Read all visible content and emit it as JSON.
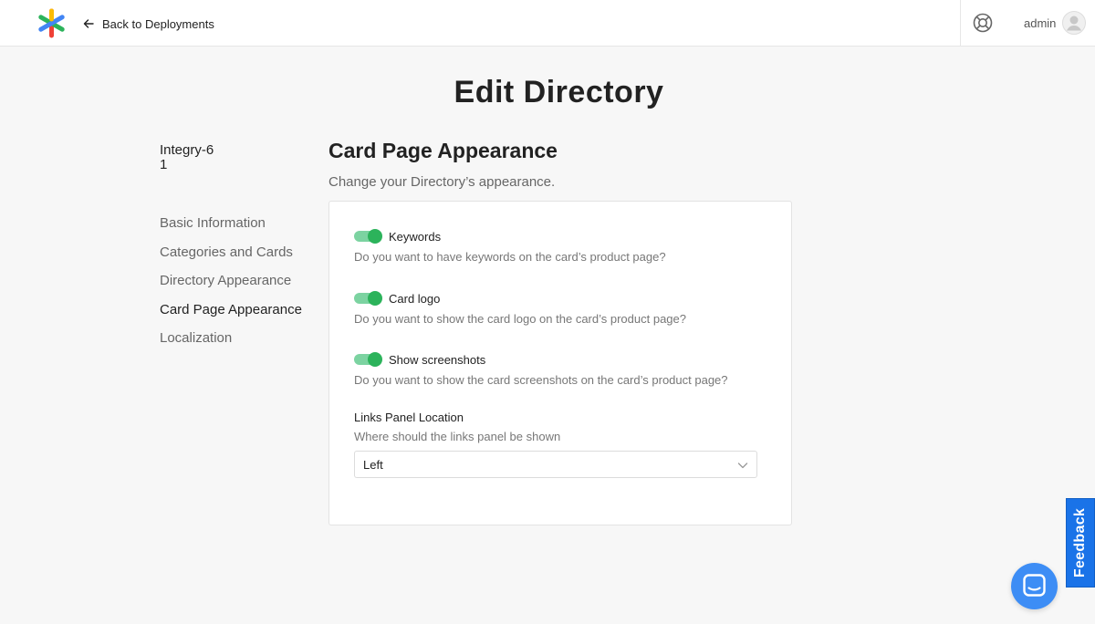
{
  "header": {
    "back_label": "Back to Deployments",
    "user_name": "admin"
  },
  "page": {
    "title": "Edit Directory"
  },
  "sidebar": {
    "directory_name": "Integry-61",
    "items": [
      {
        "label": "Basic Information",
        "active": false
      },
      {
        "label": "Categories and Cards",
        "active": false
      },
      {
        "label": "Directory Appearance",
        "active": false
      },
      {
        "label": "Card Page Appearance",
        "active": true
      },
      {
        "label": "Localization",
        "active": false
      }
    ]
  },
  "section": {
    "title": "Card Page Appearance",
    "subtitle": "Change your Directory’s appearance.",
    "settings": [
      {
        "label": "Keywords",
        "enabled": true,
        "description": "Do you want to have keywords on the card’s product page?"
      },
      {
        "label": "Card logo",
        "enabled": true,
        "description": "Do you want to show the card logo on the card’s product page?"
      },
      {
        "label": "Show screenshots",
        "enabled": true,
        "description": "Do you want to show the card screenshots on the card’s product page?"
      }
    ],
    "links_panel": {
      "title": "Links Panel Location",
      "description": "Where should the links panel be shown",
      "selected": "Left"
    }
  },
  "widgets": {
    "feedback_label": "Feedback"
  },
  "colors": {
    "toggle_on": "#2cb35b",
    "toggle_track": "#7cd3a1",
    "feedback_bg": "#1a73e8",
    "chat_bg": "#3d8df5"
  }
}
